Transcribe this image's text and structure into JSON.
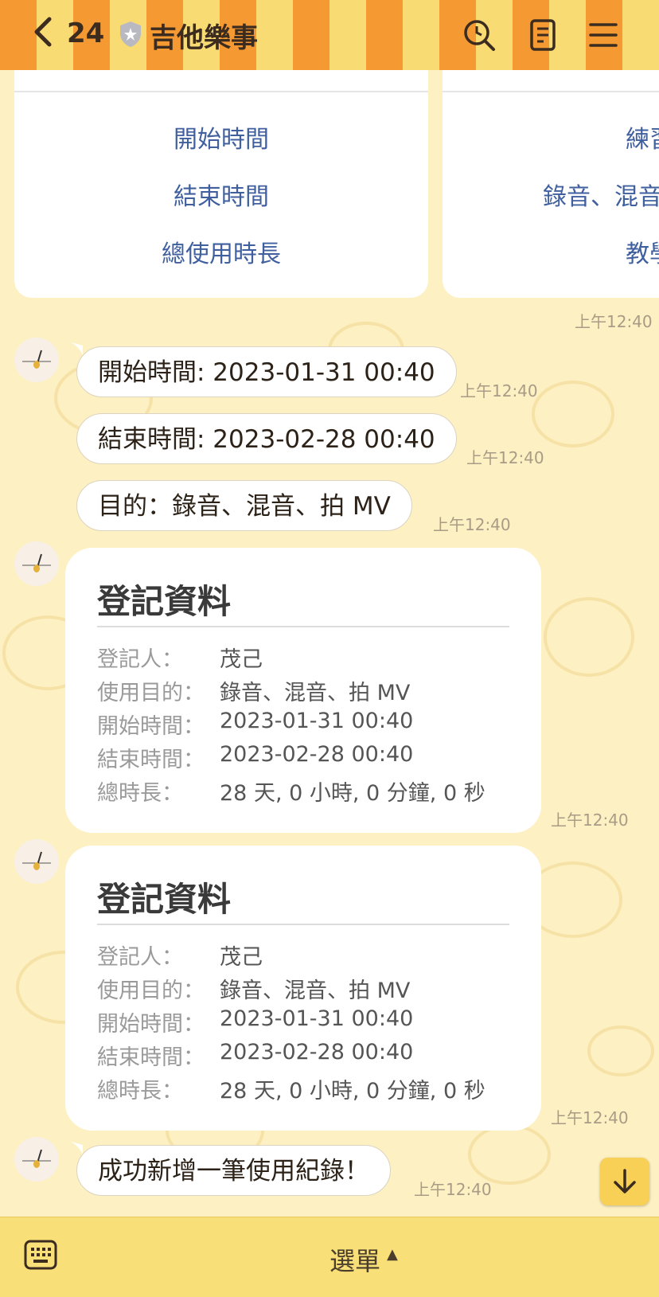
{
  "header": {
    "back_icon": "chevron-left-icon",
    "unread_count": "24",
    "chat_title": "吉他樂事",
    "icons": [
      "search-history-icon",
      "notes-icon",
      "menu-icon"
    ]
  },
  "top_cards": {
    "left": [
      "開始時間",
      "結束時間",
      "總使用時長"
    ],
    "right": [
      "練習",
      "錄音、混音",
      "教學"
    ],
    "timestamp": "上午12:40"
  },
  "messages": [
    {
      "text": "開始時間: 2023-01-31 00:40",
      "time": "上午12:40"
    },
    {
      "text": "結束時間: 2023-02-28 00:40",
      "time": "上午12:40"
    },
    {
      "text": "目的：錄音、混音、拍 MV",
      "time": "上午12:40"
    }
  ],
  "records": [
    {
      "title": "登記資料",
      "rows": [
        {
          "k": "登記人：",
          "v": "茂己"
        },
        {
          "k": "使用目的：",
          "v": "錄音、混音、拍 MV"
        },
        {
          "k": "開始時間：",
          "v": "2023-01-31 00:40"
        },
        {
          "k": "結束時間：",
          "v": "2023-02-28 00:40"
        },
        {
          "k": "總時長：",
          "v": "28 天, 0 小時, 0 分鐘, 0 秒"
        }
      ],
      "time": "上午12:40"
    },
    {
      "title": "登記資料",
      "rows": [
        {
          "k": "登記人：",
          "v": "茂己"
        },
        {
          "k": "使用目的：",
          "v": "錄音、混音、拍 MV"
        },
        {
          "k": "開始時間：",
          "v": "2023-01-31 00:40"
        },
        {
          "k": "結束時間：",
          "v": "2023-02-28 00:40"
        },
        {
          "k": "總時長：",
          "v": "28 天, 0 小時, 0 分鐘, 0 秒"
        }
      ],
      "time": "上午12:40"
    }
  ],
  "success": {
    "text": "成功新增一筆使用紀錄！",
    "time": "上午12:40"
  },
  "bottom_bar": {
    "menu_label": "選單",
    "menu_arrow": "▲",
    "keyboard_icon": "keyboard-icon"
  },
  "colors": {
    "header_orange": "#f59a33",
    "header_yellow": "#f8db73",
    "background": "#fdf0c2",
    "link_blue": "#3f5f9e",
    "bottom_bar": "#f8df78"
  }
}
